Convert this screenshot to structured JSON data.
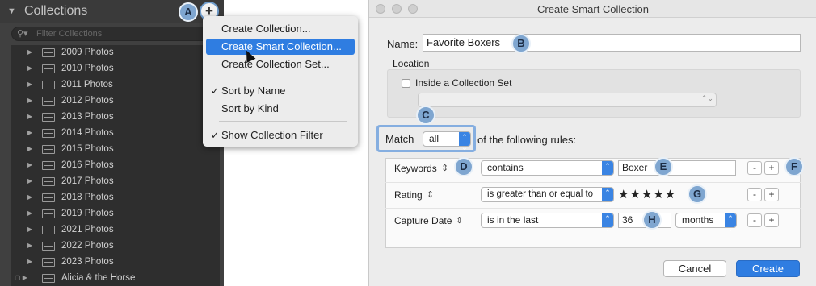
{
  "lightroom": {
    "panel_title": "Collections",
    "add_button_glyph": "+",
    "filter_placeholder": "Filter Collections",
    "collections": [
      "2009 Photos",
      "2010 Photos",
      "2011 Photos",
      "2012 Photos",
      "2013 Photos",
      "2014 Photos",
      "2015 Photos",
      "2016 Photos",
      "2017 Photos",
      "2018 Photos",
      "2019 Photos",
      "2021 Photos",
      "2022 Photos",
      "2023 Photos",
      "Alicia & the Horse"
    ]
  },
  "context_menu": {
    "items": [
      "Create Collection...",
      "Create Smart Collection...",
      "Create Collection Set...",
      "Sort by Name",
      "Sort by Kind",
      "Show Collection Filter"
    ],
    "highlighted_index": 1,
    "checked": [
      "Sort by Name",
      "Show Collection Filter"
    ]
  },
  "dialog": {
    "title": "Create Smart Collection",
    "name_label": "Name:",
    "name_value": "Favorite Boxers",
    "location_label": "Location",
    "inside_set_label": "Inside a Collection Set",
    "match_label": "Match",
    "match_value": "all",
    "following_rules_label": "of the following rules:",
    "rules": [
      {
        "field": "Keywords",
        "operator": "contains",
        "value": "Boxer"
      },
      {
        "field": "Rating",
        "operator": "is greater than or equal to",
        "value": "★★★★★"
      },
      {
        "field": "Capture Date",
        "operator": "is in the last",
        "value": "36",
        "unit": "months"
      }
    ],
    "remove_glyph": "-",
    "add_glyph": "+",
    "cancel_label": "Cancel",
    "create_label": "Create"
  },
  "callouts": [
    "A",
    "B",
    "C",
    "D",
    "E",
    "F",
    "G",
    "H"
  ],
  "colors": {
    "accent_blue": "#2f7de1",
    "callout_fill": "#7fa6d0",
    "panel_bg": "#404040"
  }
}
